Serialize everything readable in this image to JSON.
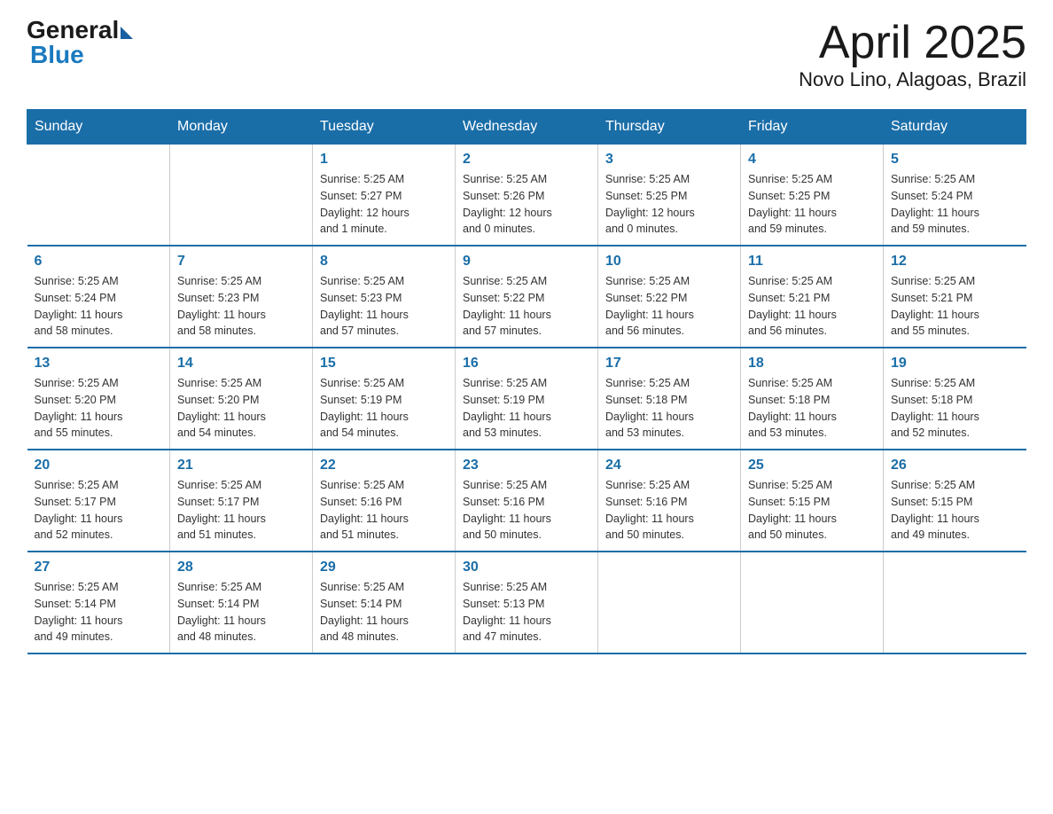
{
  "header": {
    "logo_general": "General",
    "logo_blue": "Blue",
    "title": "April 2025",
    "subtitle": "Novo Lino, Alagoas, Brazil"
  },
  "weekdays": [
    "Sunday",
    "Monday",
    "Tuesday",
    "Wednesday",
    "Thursday",
    "Friday",
    "Saturday"
  ],
  "weeks": [
    [
      {
        "day": "",
        "info": ""
      },
      {
        "day": "",
        "info": ""
      },
      {
        "day": "1",
        "info": "Sunrise: 5:25 AM\nSunset: 5:27 PM\nDaylight: 12 hours\nand 1 minute."
      },
      {
        "day": "2",
        "info": "Sunrise: 5:25 AM\nSunset: 5:26 PM\nDaylight: 12 hours\nand 0 minutes."
      },
      {
        "day": "3",
        "info": "Sunrise: 5:25 AM\nSunset: 5:25 PM\nDaylight: 12 hours\nand 0 minutes."
      },
      {
        "day": "4",
        "info": "Sunrise: 5:25 AM\nSunset: 5:25 PM\nDaylight: 11 hours\nand 59 minutes."
      },
      {
        "day": "5",
        "info": "Sunrise: 5:25 AM\nSunset: 5:24 PM\nDaylight: 11 hours\nand 59 minutes."
      }
    ],
    [
      {
        "day": "6",
        "info": "Sunrise: 5:25 AM\nSunset: 5:24 PM\nDaylight: 11 hours\nand 58 minutes."
      },
      {
        "day": "7",
        "info": "Sunrise: 5:25 AM\nSunset: 5:23 PM\nDaylight: 11 hours\nand 58 minutes."
      },
      {
        "day": "8",
        "info": "Sunrise: 5:25 AM\nSunset: 5:23 PM\nDaylight: 11 hours\nand 57 minutes."
      },
      {
        "day": "9",
        "info": "Sunrise: 5:25 AM\nSunset: 5:22 PM\nDaylight: 11 hours\nand 57 minutes."
      },
      {
        "day": "10",
        "info": "Sunrise: 5:25 AM\nSunset: 5:22 PM\nDaylight: 11 hours\nand 56 minutes."
      },
      {
        "day": "11",
        "info": "Sunrise: 5:25 AM\nSunset: 5:21 PM\nDaylight: 11 hours\nand 56 minutes."
      },
      {
        "day": "12",
        "info": "Sunrise: 5:25 AM\nSunset: 5:21 PM\nDaylight: 11 hours\nand 55 minutes."
      }
    ],
    [
      {
        "day": "13",
        "info": "Sunrise: 5:25 AM\nSunset: 5:20 PM\nDaylight: 11 hours\nand 55 minutes."
      },
      {
        "day": "14",
        "info": "Sunrise: 5:25 AM\nSunset: 5:20 PM\nDaylight: 11 hours\nand 54 minutes."
      },
      {
        "day": "15",
        "info": "Sunrise: 5:25 AM\nSunset: 5:19 PM\nDaylight: 11 hours\nand 54 minutes."
      },
      {
        "day": "16",
        "info": "Sunrise: 5:25 AM\nSunset: 5:19 PM\nDaylight: 11 hours\nand 53 minutes."
      },
      {
        "day": "17",
        "info": "Sunrise: 5:25 AM\nSunset: 5:18 PM\nDaylight: 11 hours\nand 53 minutes."
      },
      {
        "day": "18",
        "info": "Sunrise: 5:25 AM\nSunset: 5:18 PM\nDaylight: 11 hours\nand 53 minutes."
      },
      {
        "day": "19",
        "info": "Sunrise: 5:25 AM\nSunset: 5:18 PM\nDaylight: 11 hours\nand 52 minutes."
      }
    ],
    [
      {
        "day": "20",
        "info": "Sunrise: 5:25 AM\nSunset: 5:17 PM\nDaylight: 11 hours\nand 52 minutes."
      },
      {
        "day": "21",
        "info": "Sunrise: 5:25 AM\nSunset: 5:17 PM\nDaylight: 11 hours\nand 51 minutes."
      },
      {
        "day": "22",
        "info": "Sunrise: 5:25 AM\nSunset: 5:16 PM\nDaylight: 11 hours\nand 51 minutes."
      },
      {
        "day": "23",
        "info": "Sunrise: 5:25 AM\nSunset: 5:16 PM\nDaylight: 11 hours\nand 50 minutes."
      },
      {
        "day": "24",
        "info": "Sunrise: 5:25 AM\nSunset: 5:16 PM\nDaylight: 11 hours\nand 50 minutes."
      },
      {
        "day": "25",
        "info": "Sunrise: 5:25 AM\nSunset: 5:15 PM\nDaylight: 11 hours\nand 50 minutes."
      },
      {
        "day": "26",
        "info": "Sunrise: 5:25 AM\nSunset: 5:15 PM\nDaylight: 11 hours\nand 49 minutes."
      }
    ],
    [
      {
        "day": "27",
        "info": "Sunrise: 5:25 AM\nSunset: 5:14 PM\nDaylight: 11 hours\nand 49 minutes."
      },
      {
        "day": "28",
        "info": "Sunrise: 5:25 AM\nSunset: 5:14 PM\nDaylight: 11 hours\nand 48 minutes."
      },
      {
        "day": "29",
        "info": "Sunrise: 5:25 AM\nSunset: 5:14 PM\nDaylight: 11 hours\nand 48 minutes."
      },
      {
        "day": "30",
        "info": "Sunrise: 5:25 AM\nSunset: 5:13 PM\nDaylight: 11 hours\nand 47 minutes."
      },
      {
        "day": "",
        "info": ""
      },
      {
        "day": "",
        "info": ""
      },
      {
        "day": "",
        "info": ""
      }
    ]
  ]
}
